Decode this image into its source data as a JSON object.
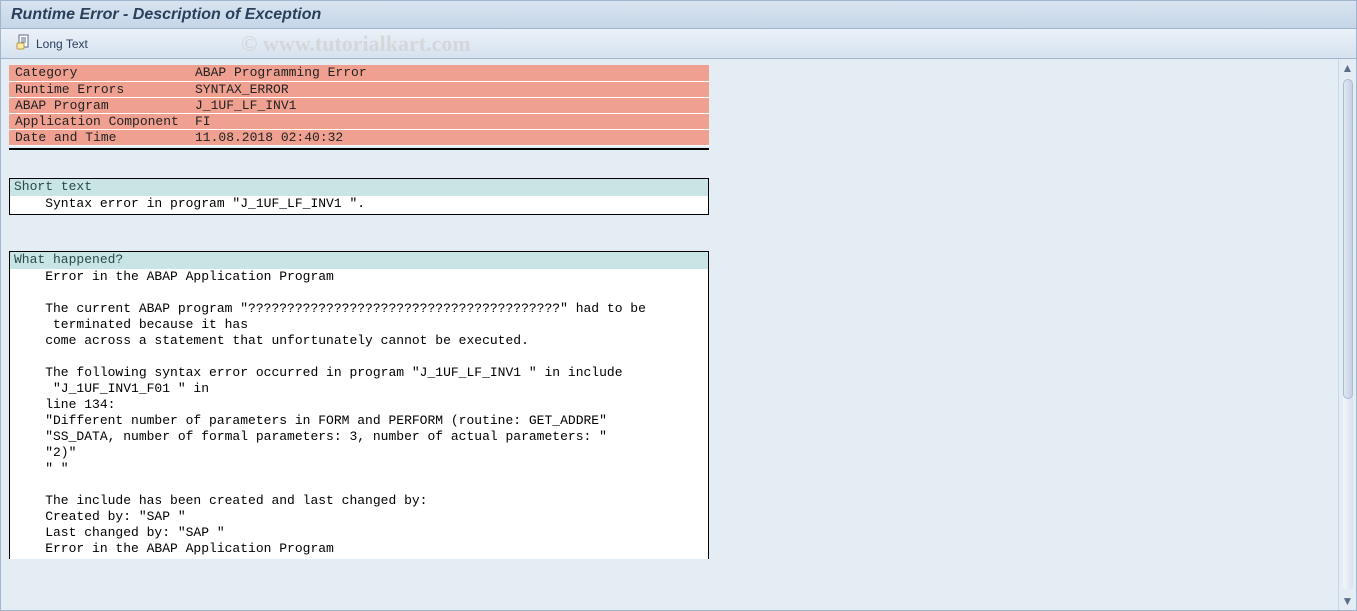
{
  "title": "Runtime Error - Description of Exception",
  "toolbar": {
    "long_text": "Long Text"
  },
  "summary": {
    "category_lbl": "Category",
    "category_val": "ABAP Programming Error",
    "rerr_lbl": "Runtime Errors",
    "rerr_val": "SYNTAX_ERROR",
    "prog_lbl": "ABAP Program",
    "prog_val": "J_1UF_LF_INV1",
    "appc_lbl": "Application Component",
    "appc_val": "FI",
    "date_lbl": "Date and Time",
    "date_val": "11.08.2018 02:40:32"
  },
  "short": {
    "header": "Short text",
    "body": "    Syntax error in program \"J_1UF_LF_INV1 \"."
  },
  "what": {
    "header": "What happened?",
    "body": "    Error in the ABAP Application Program\n\n    The current ABAP program \"????????????????????????????????????????\" had to be\n     terminated because it has\n    come across a statement that unfortunately cannot be executed.\n\n    The following syntax error occurred in program \"J_1UF_LF_INV1 \" in include\n     \"J_1UF_INV1_F01 \" in\n    line 134:\n    \"Different number of parameters in FORM and PERFORM (routine: GET_ADDRE\"\n    \"SS_DATA, number of formal parameters: 3, number of actual parameters: \"\n    \"2)\"\n    \" \"\n\n    The include has been created and last changed by:\n    Created by: \"SAP \"\n    Last changed by: \"SAP \"\n    Error in the ABAP Application Program"
  }
}
